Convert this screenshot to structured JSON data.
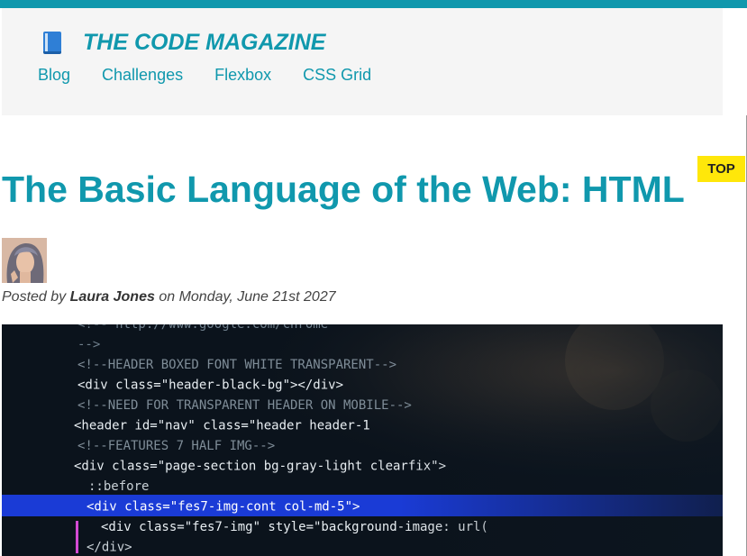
{
  "brand": {
    "title": "THE CODE MAGAZINE",
    "icon": "blue-book-icon"
  },
  "nav": [
    "Blog",
    "Challenges",
    "Flexbox",
    "CSS Grid"
  ],
  "top_button": "TOP",
  "post": {
    "title": "The Basic Language of the Web: HTML",
    "author": "Laura Jones",
    "date": "Monday, June 21st 2027",
    "posted_by": "Posted by",
    "on": "on"
  },
  "code_lines": [
    "<!-- http://www.google.com/chrome",
    "-->",
    "<!--HEADER BOXED FONT WHITE TRANSPARENT-->",
    "<div class=\"header-black-bg\"></div>",
    "<!--NEED FOR TRANSPARENT HEADER ON MOBILE-->",
    "<header id=\"nav\" class=\"header header-1",
    "<!--FEATURES 7 HALF IMG-->",
    "<div class=\"page-section bg-gray-light clearfix\">",
    "::before",
    "<div class=\"fes7-img-cont col-md-5\">",
    "<div class=\"fes7-img\" style=\"background-image: url(",
    "</div>"
  ]
}
